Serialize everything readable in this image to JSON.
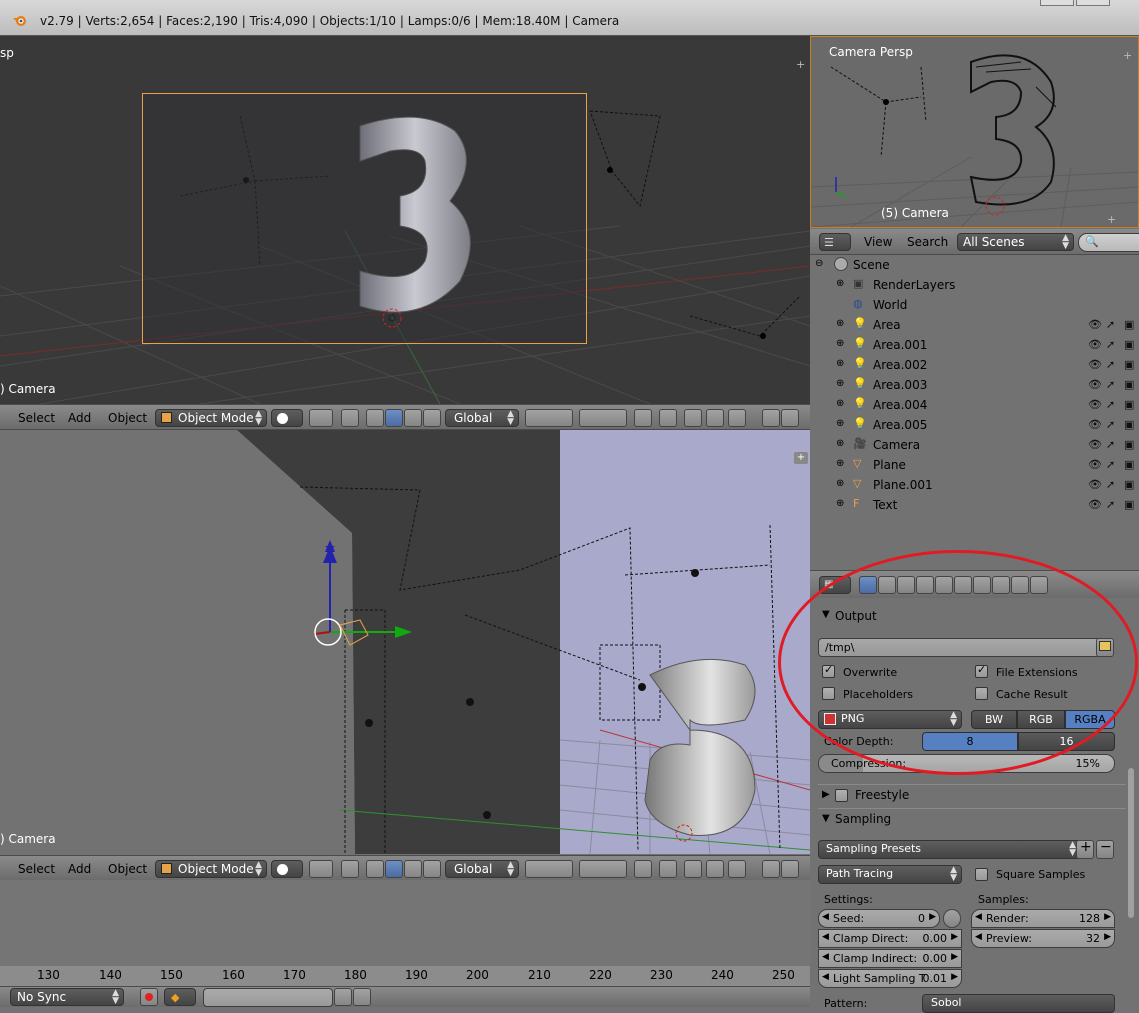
{
  "info": {
    "stats": "v2.79 | Verts:2,654 | Faces:2,190 | Tris:4,090 | Objects:1/10 | Lamps:0/6 | Mem:18.40M | Camera"
  },
  "viewport_top": {
    "view_label": "sp",
    "object_label": ") Camera"
  },
  "viewport_bottom": {
    "object_label": ") Camera"
  },
  "view3d_header": {
    "select": "Select",
    "add": "Add",
    "object": "Object",
    "mode": "Object Mode",
    "orientation": "Global"
  },
  "camera_view": {
    "title": "Camera Persp",
    "object_label": "(5) Camera"
  },
  "outliner_header": {
    "view": "View",
    "search": "Search",
    "scenes": "All Scenes"
  },
  "outliner": {
    "scene": "Scene",
    "items": [
      {
        "name": "RenderLayers",
        "icon": "renderlayers-icon"
      },
      {
        "name": "World",
        "icon": "world-icon"
      },
      {
        "name": "Area",
        "icon": "lamp-icon"
      },
      {
        "name": "Area.001",
        "icon": "lamp-icon"
      },
      {
        "name": "Area.002",
        "icon": "lamp-icon"
      },
      {
        "name": "Area.003",
        "icon": "lamp-icon"
      },
      {
        "name": "Area.004",
        "icon": "lamp-icon"
      },
      {
        "name": "Area.005",
        "icon": "lamp-icon"
      },
      {
        "name": "Camera",
        "icon": "camera-icon"
      },
      {
        "name": "Plane",
        "icon": "mesh-icon"
      },
      {
        "name": "Plane.001",
        "icon": "mesh-icon"
      },
      {
        "name": "Text",
        "icon": "text-icon"
      }
    ]
  },
  "output_panel": {
    "title": "Output",
    "path": "/tmp\\",
    "overwrite": "Overwrite",
    "file_extensions": "File Extensions",
    "placeholders": "Placeholders",
    "cache_result": "Cache Result",
    "format": "PNG",
    "color_modes": [
      "BW",
      "RGB",
      "RGBA"
    ],
    "color_mode_selected": "RGBA",
    "color_depth_label": "Color Depth:",
    "depth_8": "8",
    "depth_16": "16",
    "compression_label": "Compression:",
    "compression_value": "15%",
    "compression_fraction": 0.15
  },
  "freestyle_panel": {
    "title": "Freestyle"
  },
  "sampling_panel": {
    "title": "Sampling",
    "presets": "Sampling Presets",
    "integrator": "Path Tracing",
    "square_samples": "Square Samples",
    "settings_label": "Settings:",
    "samples_label": "Samples:",
    "seed_label": "Seed:",
    "seed_value": "0",
    "clamp_direct_label": "Clamp Direct:",
    "clamp_direct_value": "0.00",
    "clamp_indirect_label": "Clamp Indirect:",
    "clamp_indirect_value": "0.00",
    "light_sampling_label": "Light Sampling T",
    "light_sampling_value": "0.01",
    "render_label": "Render:",
    "render_value": "128",
    "preview_label": "Preview:",
    "preview_value": "32",
    "pattern_label": "Pattern:",
    "pattern_value": "Sobol"
  },
  "timeline": {
    "numbers": [
      "130",
      "140",
      "150",
      "160",
      "170",
      "180",
      "190",
      "200",
      "210",
      "220",
      "230",
      "240",
      "250"
    ]
  },
  "footer": {
    "sync": "No Sync"
  },
  "colors": {
    "annotation": "#e01b24",
    "selected_blue": "#5680c2",
    "camera_frame": "#e8a24a"
  }
}
